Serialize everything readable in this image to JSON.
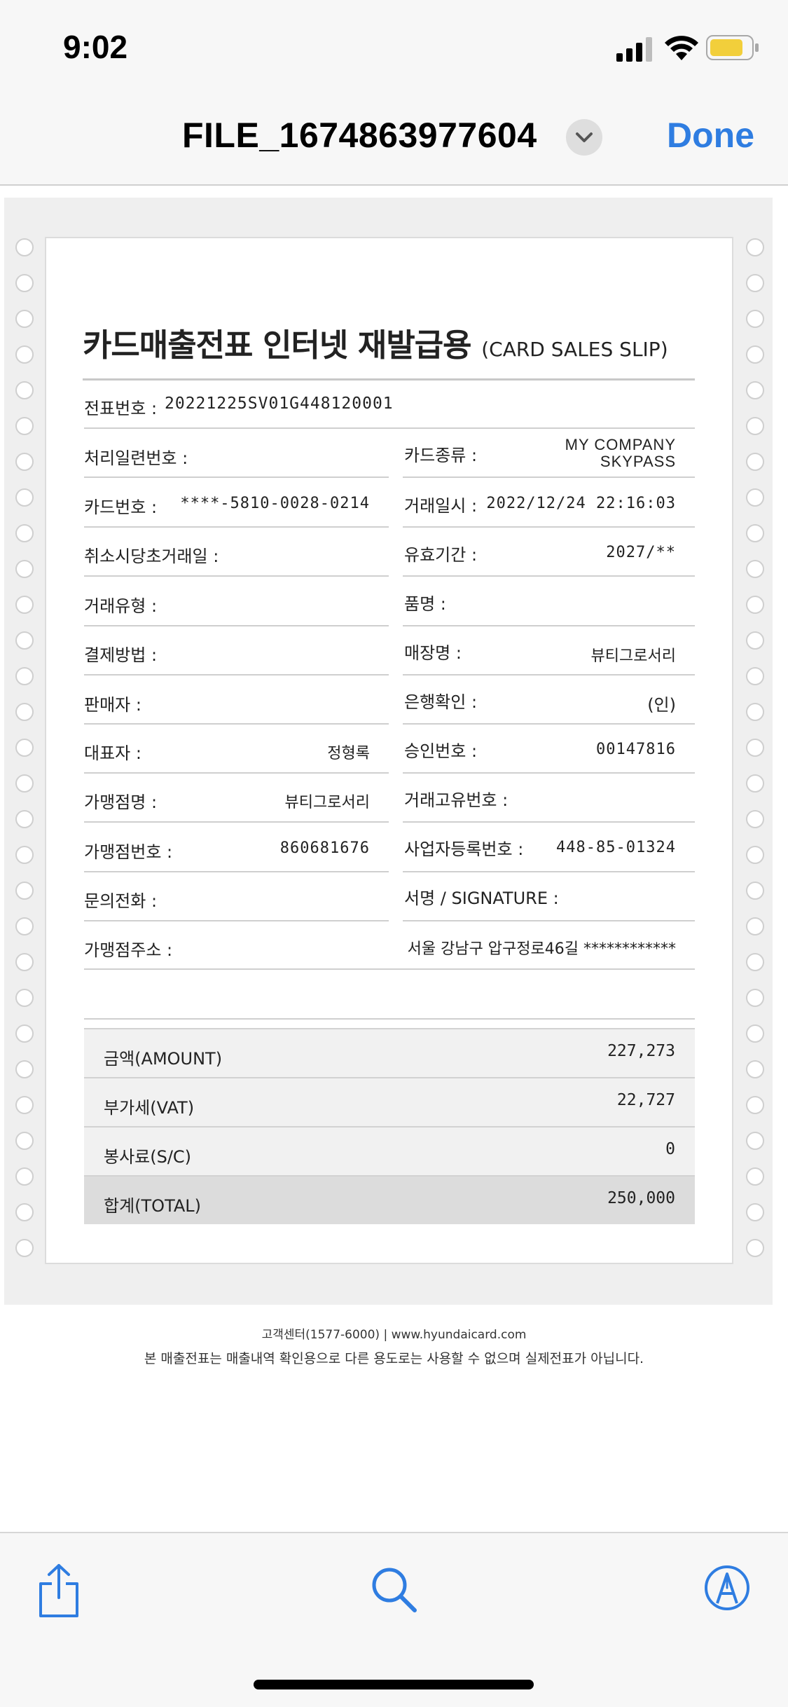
{
  "status": {
    "time": "9:02",
    "battery_color": "#f2cf3b"
  },
  "nav": {
    "title": "FILE_1674863977604",
    "done_label": "Done",
    "accent": "#2f7de1"
  },
  "slip": {
    "title": "카드매출전표 인터넷 재발급용",
    "subtitle": "(CARD SALES SLIP)",
    "slip_no_label": "전표번호 :",
    "slip_no_value": "20221225SV01G448120001",
    "left": [
      {
        "label": "처리일련번호 :",
        "value": ""
      },
      {
        "label": "카드번호 :",
        "value": "****-5810-0028-0214"
      },
      {
        "label": "취소시당초거래일 :",
        "value": ""
      },
      {
        "label": "거래유형 :",
        "value": ""
      },
      {
        "label": "결제방법 :",
        "value": ""
      },
      {
        "label": "판매자 :",
        "value": ""
      },
      {
        "label": "대표자 :",
        "value": "정형록"
      },
      {
        "label": "가맹점명 :",
        "value": "뷰티그로서리"
      },
      {
        "label": "가맹점번호 :",
        "value": "860681676"
      },
      {
        "label": "문의전화 :",
        "value": ""
      }
    ],
    "right": [
      {
        "label": "카드종류 :",
        "value": "MY COMPANY",
        "value2": "SKYPASS"
      },
      {
        "label": "거래일시 :",
        "value": "2022/12/24 22:16:03"
      },
      {
        "label": "유효기간 :",
        "value": "2027/**"
      },
      {
        "label": "품명 :",
        "value": ""
      },
      {
        "label": "매장명 :",
        "value": "뷰티그로서리"
      },
      {
        "label": "은행확인 :",
        "value": "(인)"
      },
      {
        "label": "승인번호 :",
        "value": "00147816"
      },
      {
        "label": "거래고유번호 :",
        "value": ""
      },
      {
        "label": "사업자등록번호 :",
        "value": "448-85-01324"
      },
      {
        "label": "서명 / SIGNATURE :",
        "value": ""
      }
    ],
    "address_label": "가맹점주소 :",
    "address_value": "서울 강남구 압구정로46길 ************",
    "amounts": [
      {
        "label": "금액(AMOUNT)",
        "value": "227,273"
      },
      {
        "label": "부가세(VAT)",
        "value": "22,727"
      },
      {
        "label": "봉사료(S/C)",
        "value": "0"
      },
      {
        "label": "합계(TOTAL)",
        "value": "250,000"
      }
    ]
  },
  "footer": {
    "contact": "고객센터(1577-6000)  |  www.hyundaicard.com",
    "notice": "본 매출전표는 매출내역 확인용으로 다른 용도로는 사용할 수 없으며 실제전표가 아닙니다."
  },
  "toolbar": {
    "icons": [
      "share-icon",
      "search-icon",
      "markup-icon"
    ]
  }
}
